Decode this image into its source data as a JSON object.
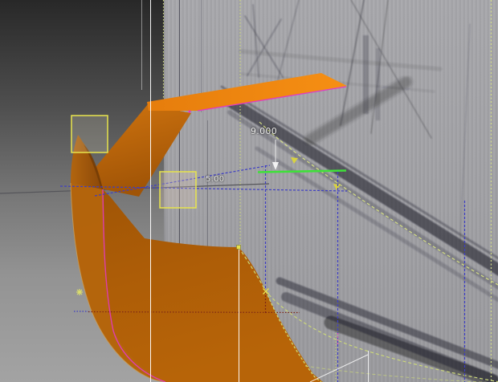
{
  "viewport": {
    "type": "cad-3d-viewport",
    "description": "CAD surface modeling view over faded ship reference photo"
  },
  "dimensions": {
    "vertical_dim": "9.000",
    "horizontal_dim": "5.00"
  },
  "colors": {
    "surface_band_orange": "#ef8410",
    "surface_face_orange": "#c06a0e",
    "surface_sheet_orange": "#ab5c08",
    "highlight_magenta": "#e23bbf",
    "selected_edge_green": "#3fe03a",
    "construction_khaki": "#cdd87e",
    "construction_blue": "#3d3dc4",
    "hidden_line_red": "#7d2616",
    "selection_yellow": "#e8e44c",
    "axis_white": "#ffffff"
  },
  "markers": {
    "selection_box_1": "selection-box",
    "selection_box_2": "selection-box",
    "point_marker_1": "vertex-point-marker",
    "point_marker_2": "vertex-point-marker",
    "star_marker": "snap-star-marker",
    "arrow_marker": "curve-direction-arrow"
  }
}
